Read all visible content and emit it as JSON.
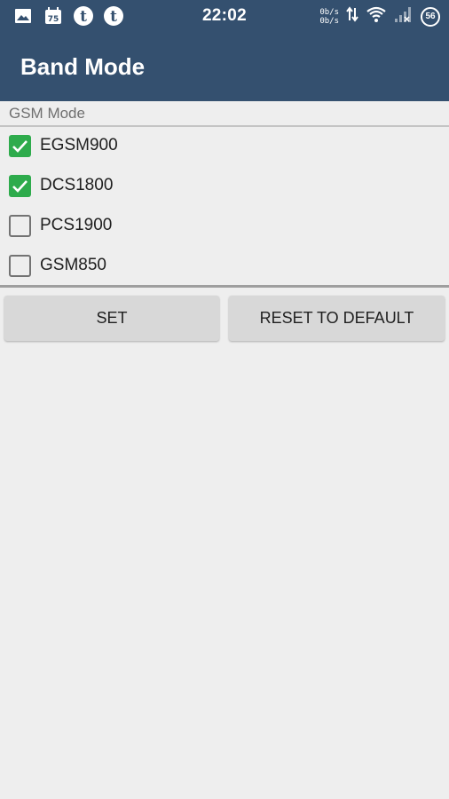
{
  "status_bar": {
    "time": "22:02",
    "notification_badge": "75",
    "speed_up": "0b/s",
    "speed_down": "0b/s",
    "battery": "56",
    "icons": [
      "image-icon",
      "calendar-icon",
      "tumblr-icon",
      "tumblr-icon",
      "data-arrows-icon",
      "wifi-icon",
      "signal-icon",
      "battery-icon"
    ]
  },
  "app_bar": {
    "title": "Band Mode"
  },
  "section": {
    "label": "GSM Mode"
  },
  "bands": [
    {
      "label": "EGSM900",
      "checked": true
    },
    {
      "label": "DCS1800",
      "checked": true
    },
    {
      "label": "PCS1900",
      "checked": false
    },
    {
      "label": "GSM850",
      "checked": false
    }
  ],
  "buttons": {
    "set": "SET",
    "reset": "RESET TO DEFAULT"
  },
  "colors": {
    "header": "#34506f",
    "checkbox_checked": "#2eab4c",
    "background": "#eeeeee",
    "button": "#d8d8d8"
  }
}
